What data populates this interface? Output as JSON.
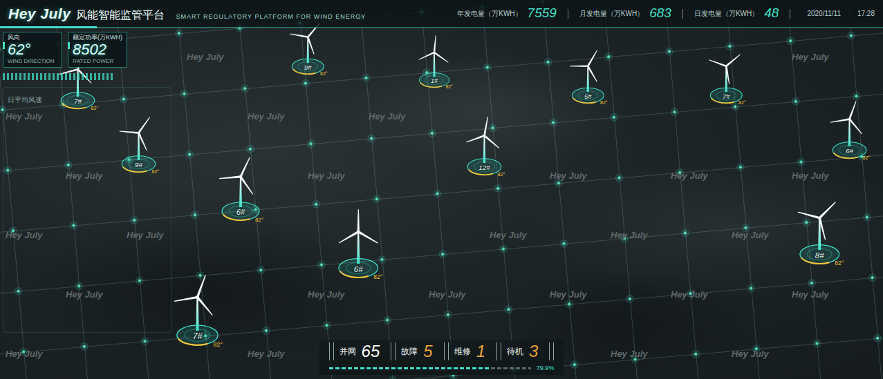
{
  "header": {
    "logo": "Hey July",
    "title": "风能智能监管平台",
    "subtitle": "SMART REGULATORY PLATFORM FOR WIND ENERGY",
    "stats": [
      {
        "label": "年发电量（万KWH）",
        "value": "7559"
      },
      {
        "label": "月发电量（万KWH）",
        "value": "683"
      },
      {
        "label": "日发电量（万KWH）",
        "value": "48"
      }
    ],
    "date": "2020/11/11",
    "time": "17:28"
  },
  "indicators": [
    {
      "label": "风向",
      "value": "62°",
      "caption": "WIND DIRECTION"
    },
    {
      "label": "额定功率(万KWH)",
      "value": "8502",
      "caption": "RATED POWER"
    }
  ],
  "left_panel": {
    "title": "日平均风速"
  },
  "watermark": "Hey July",
  "turbines": [
    {
      "label": "7#",
      "tag": "82°"
    },
    {
      "label": "9#",
      "tag": "82°"
    },
    {
      "label": "1#",
      "tag": "82°"
    },
    {
      "label": "5#",
      "tag": "82°"
    },
    {
      "label": "7#",
      "tag": "82°"
    },
    {
      "label": "6#",
      "tag": "82°"
    },
    {
      "label": "9#",
      "tag": "82°"
    },
    {
      "label": "12#",
      "tag": "82°"
    },
    {
      "label": "6#",
      "tag": "82°"
    },
    {
      "label": "8#",
      "tag": "82°"
    },
    {
      "label": "6#",
      "tag": "82°"
    },
    {
      "label": "7#",
      "tag": "82°"
    }
  ],
  "status_bar": {
    "items": [
      {
        "label": "并网",
        "value": "65",
        "color": "#ffffff"
      },
      {
        "label": "故障",
        "value": "5",
        "color": "#e8a23a"
      },
      {
        "label": "维修",
        "value": "1",
        "color": "#e8a23a"
      },
      {
        "label": "待机",
        "value": "3",
        "color": "#e8a23a"
      }
    ],
    "progress": {
      "level": 0.799,
      "reading": "79.9%"
    }
  }
}
